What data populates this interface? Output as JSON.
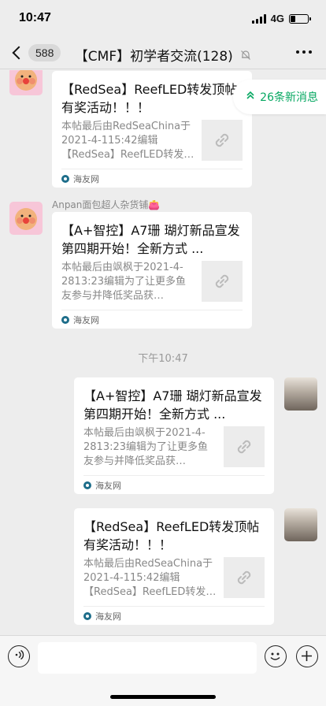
{
  "status": {
    "time": "10:47",
    "network": "4G"
  },
  "nav": {
    "unread_count": "588",
    "title": "【CMF】初学者交流(128)"
  },
  "new_messages": {
    "label": "26条新消息"
  },
  "messages": [
    {
      "title": "【RedSea】ReefLED转发顶帖有奖活动！！！",
      "desc": "本帖最后由RedSeaChina于2021-4-115:42编辑【RedSea】ReefLED转发…",
      "source": "海友网"
    },
    {
      "sender": "Anpan面包超人杂货铺👛",
      "title": "【A+智控】A7珊 瑚灯新品宣发 第四期开始！全新方式 ...",
      "desc": "本帖最后由飒枫于2021-4-2813:23编辑为了让更多鱼友参与并降低奖品获…",
      "source": "海友网"
    },
    {
      "title": "【A+智控】A7珊 瑚灯新品宣发 第四期开始！全新方式 ...",
      "desc": "本帖最后由飒枫于2021-4-2813:23编辑为了让更多鱼友参与并降低奖品获…",
      "source": "海友网"
    },
    {
      "title": "【RedSea】ReefLED转发顶帖有奖活动！！！",
      "desc": "本帖最后由RedSeaChina于2021-4-115:42编辑【RedSea】ReefLED转发…",
      "source": "海友网"
    }
  ],
  "time_divider": "下午10:47",
  "input": {
    "value": ""
  },
  "icons": {
    "back": "chevron-left-icon",
    "mute": "bell-off-icon",
    "more": "more-dots-icon",
    "link": "link-icon",
    "voice": "voice-icon",
    "emoji": "emoji-icon",
    "plus": "plus-icon",
    "new_msg": "double-chevron-up-icon"
  },
  "colors": {
    "accent_green": "#07a862",
    "background": "#ededed",
    "card": "#ffffff"
  }
}
